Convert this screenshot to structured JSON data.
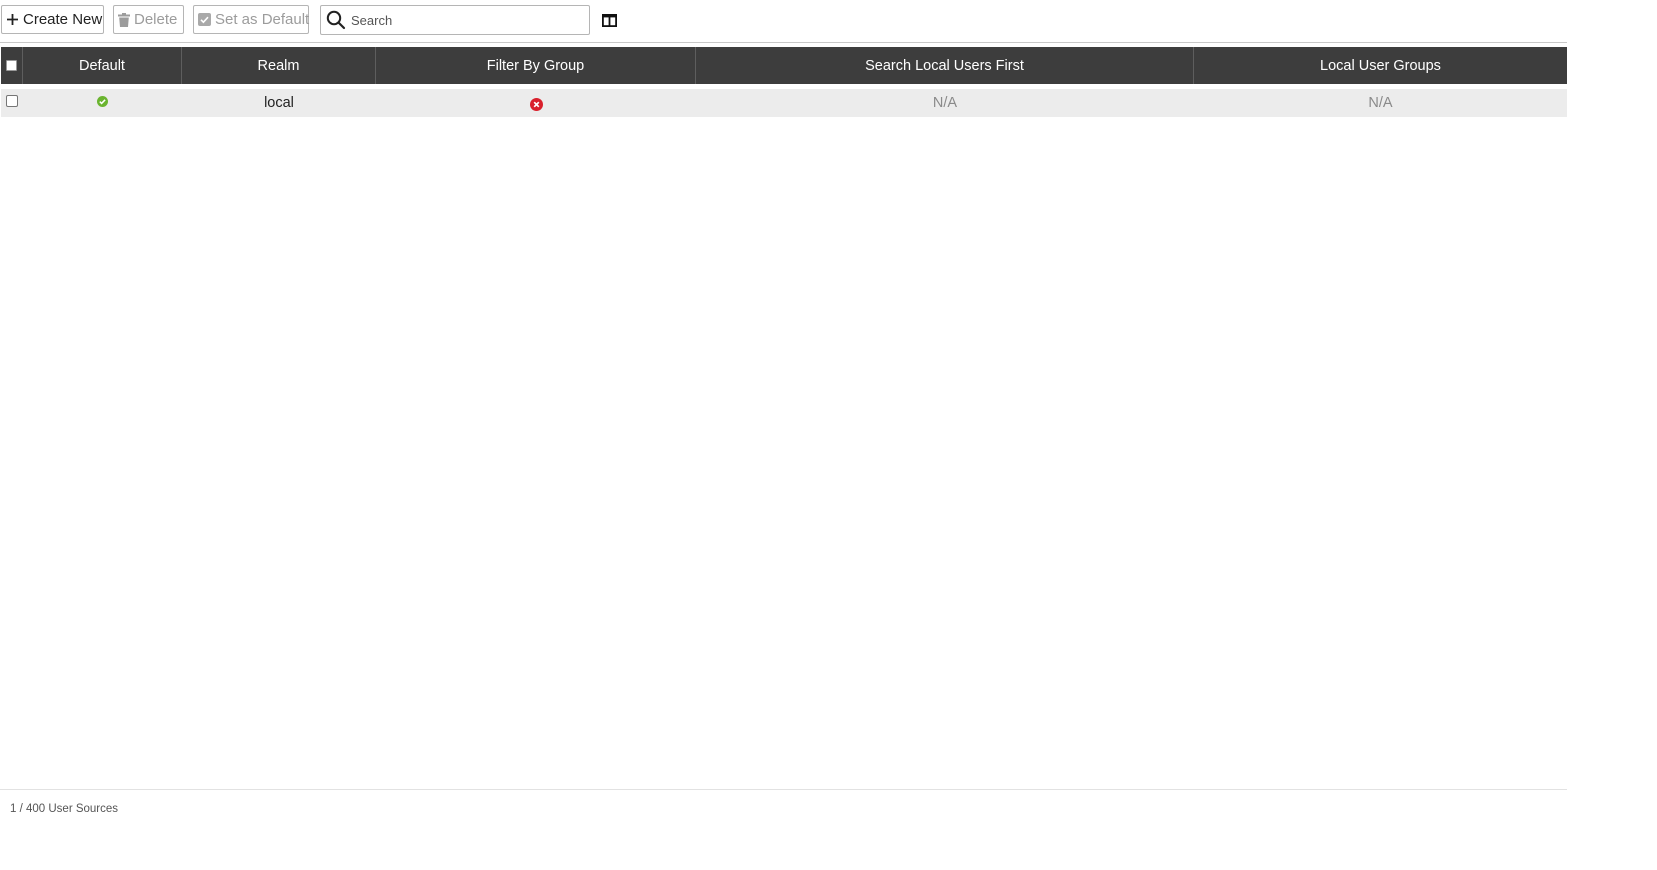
{
  "toolbar": {
    "create_label": "Create New",
    "delete_label": "Delete",
    "set_default_label": "Set as Default",
    "search_placeholder": "Search"
  },
  "table": {
    "columns": [
      "Default",
      "Realm",
      "Filter By Group",
      "Search Local Users First",
      "Local User Groups"
    ],
    "rows": [
      {
        "default": "enabled",
        "realm": "local",
        "filter_by_group": "disabled",
        "search_local_users_first": "N/A",
        "local_user_groups": "N/A"
      }
    ]
  },
  "footer": {
    "count_text": "1 / 400 User Sources"
  },
  "colors": {
    "header_bg": "#3d3d3d",
    "row_bg": "#ececec",
    "success": "#6ab42f",
    "error": "#d9202c"
  },
  "icons": {
    "create": "plus-icon",
    "delete": "trash-icon",
    "set_default": "checkbox-check-icon",
    "search": "search-icon",
    "columns": "column-settings-icon",
    "default_status": "check-circle-icon",
    "filter_status": "x-circle-icon"
  }
}
